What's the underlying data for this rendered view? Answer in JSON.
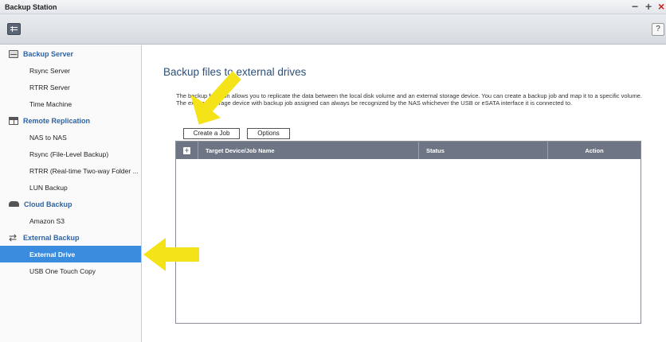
{
  "window": {
    "title": "Backup Station",
    "controls": {
      "minimize": "−",
      "maximize": "+",
      "close": "×"
    },
    "help": "?"
  },
  "sidebar": {
    "groups": [
      {
        "label": "Backup Server",
        "icon": "server-icon",
        "items": [
          "Rsync Server",
          "RTRR Server",
          "Time Machine"
        ]
      },
      {
        "label": "Remote Replication",
        "icon": "remote-replication-icon",
        "items": [
          "NAS to NAS",
          "Rsync (File-Level Backup)",
          "RTRR (Real-time Two-way Folder ...",
          "LUN Backup"
        ]
      },
      {
        "label": "Cloud Backup",
        "icon": "cloud-icon",
        "items": [
          "Amazon S3"
        ]
      },
      {
        "label": "External Backup",
        "icon": "sync-icon",
        "items": [
          "External Drive",
          "USB One Touch Copy"
        ]
      }
    ],
    "active_item": "External Drive"
  },
  "main": {
    "title": "Backup files to external drives",
    "description": "The backup function allows you to replicate the data between the local disk volume and an external storage device. You can create a backup job and map it to a specific volume. The external storage device with backup job assigned can always be recognized by the NAS whichever the USB or eSATA interface it is connected to.",
    "buttons": {
      "create": "Create a Job",
      "options": "Options"
    },
    "table": {
      "add_icon": "+",
      "columns": [
        "Target Device/Job Name",
        "Status",
        "Action"
      ],
      "rows": []
    }
  },
  "colors": {
    "accent_blue": "#3a8dde",
    "group_label": "#2d63a4",
    "table_header": "#6e7685",
    "annotation_arrow": "#f5e31a"
  }
}
